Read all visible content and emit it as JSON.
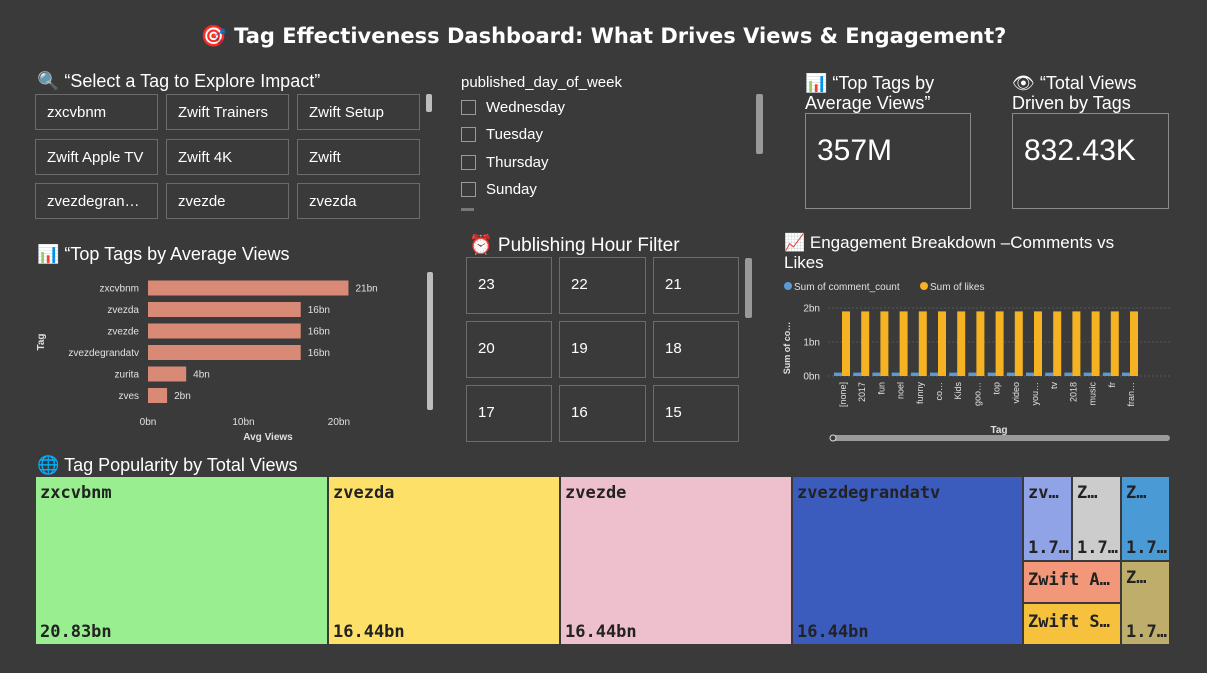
{
  "title": "🎯 Tag Effectiveness Dashboard: What Drives Views & Engagement?",
  "tag_slicer": {
    "heading": "🔍 “Select a Tag to Explore Impact”",
    "tags": [
      "zxcvbnm",
      "Zwift Trainers",
      "Zwift Setup",
      "Zwift Apple TV",
      "Zwift 4K",
      "Zwift",
      "zvezdegran…",
      "zvezde",
      "zvezda"
    ]
  },
  "day_slicer": {
    "heading": "published_day_of_week",
    "days": [
      "Wednesday",
      "Tuesday",
      "Thursday",
      "Sunday"
    ]
  },
  "kpi1": {
    "heading_line1": "📊 “Top Tags by",
    "heading_line2": "Average Views”",
    "value": "357M"
  },
  "kpi2": {
    "heading_line1": "👁 “Total Views",
    "heading_line2": "Driven by Tags",
    "value": "832.43K"
  },
  "hour_filter": {
    "heading": "⏰ Publishing Hour Filter",
    "hours": [
      "23",
      "22",
      "21",
      "20",
      "19",
      "18",
      "17",
      "16",
      "15"
    ]
  },
  "bar_heading": "📊 “Top Tags by Average Views",
  "engagement_heading_line1": "📈 Engagement Breakdown –Comments vs",
  "engagement_heading_line2": "Likes",
  "treemap_heading": "🌐 Tag Popularity by Total Views",
  "colors": {
    "bar": "#d98a76",
    "comments": "#5b9bd5",
    "likes": "#f5b324"
  },
  "chart_data": [
    {
      "type": "bar",
      "orientation": "horizontal",
      "categories": [
        "zxcvbnm",
        "zvezda",
        "zvezde",
        "zvezdegrandatv",
        "zurita",
        "zves"
      ],
      "values": [
        21,
        16,
        16,
        16,
        4,
        2
      ],
      "data_labels": [
        "21bn",
        "16bn",
        "16bn",
        "16bn",
        "4bn",
        "2bn"
      ],
      "xlabel": "Avg Views",
      "ylabel": "Tag",
      "xticks": [
        "0bn",
        "10bn",
        "20bn"
      ],
      "xlim": [
        0,
        22
      ]
    },
    {
      "type": "bar",
      "categories": [
        "[none]",
        "2017",
        "fun",
        "noel",
        "funny",
        "co…",
        "Kids",
        "goo…",
        "top",
        "video",
        "you…",
        "tv",
        "2018",
        "music",
        "fr",
        "fran…"
      ],
      "series": [
        {
          "name": "Sum of comment_count",
          "values": [
            0.1,
            0.1,
            0.1,
            0.1,
            0.1,
            0.1,
            0.1,
            0.1,
            0.1,
            0.1,
            0.1,
            0.1,
            0.1,
            0.1,
            0.1,
            0.1
          ]
        },
        {
          "name": "Sum of likes",
          "values": [
            1.9,
            1.9,
            1.9,
            1.9,
            1.9,
            1.9,
            1.9,
            1.9,
            1.9,
            1.9,
            1.9,
            1.9,
            1.9,
            1.9,
            1.9,
            1.9
          ]
        }
      ],
      "xlabel": "Tag",
      "ylabel": "Sum of co…",
      "yticks": [
        "0bn",
        "1bn",
        "2bn"
      ],
      "ylim": [
        0,
        2
      ]
    },
    {
      "type": "treemap",
      "items": [
        {
          "name": "zxcvbnm",
          "label": "20.83bn",
          "value": 20.83,
          "color": "#99ee90"
        },
        {
          "name": "zvezda",
          "label": "16.44bn",
          "value": 16.44,
          "color": "#fde068"
        },
        {
          "name": "zvezde",
          "label": "16.44bn",
          "value": 16.44,
          "color": "#eebfcc"
        },
        {
          "name": "zvezdegrandatv",
          "label": "16.44bn",
          "value": 16.44,
          "color": "#3b5bbd"
        },
        {
          "name": "zv…",
          "label": "1.7…",
          "color": "#8fa3e6"
        },
        {
          "name": "Z…",
          "label": "1.7…",
          "color": "#cccccc"
        },
        {
          "name": "Z…",
          "label": "1.7…",
          "color": "#4a9ad6"
        },
        {
          "name": "Zwift A…",
          "label": "",
          "color": "#f2977a"
        },
        {
          "name": "Zwift S…",
          "label": "",
          "color": "#f6c13d"
        },
        {
          "name": "Z…",
          "label": "1.7…",
          "color": "#bfae6b"
        }
      ]
    }
  ]
}
